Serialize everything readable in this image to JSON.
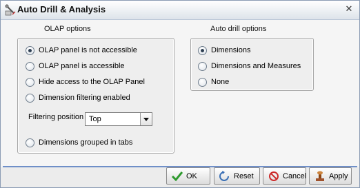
{
  "window": {
    "title": "Auto Drill & Analysis"
  },
  "olap": {
    "heading": "OLAP options",
    "options": [
      {
        "label": "OLAP panel is not accessible",
        "checked": true
      },
      {
        "label": "OLAP panel is accessible",
        "checked": false
      },
      {
        "label": "Hide access to the OLAP Panel",
        "checked": false
      },
      {
        "label": "Dimension filtering enabled",
        "checked": false
      }
    ],
    "filtering_position_label": "Filtering position",
    "filtering_position_value": "Top",
    "grouped_option": {
      "label": "Dimensions grouped in tabs",
      "checked": false
    }
  },
  "autodrill": {
    "heading": "Auto drill options",
    "options": [
      {
        "label": "Dimensions",
        "checked": true
      },
      {
        "label": "Dimensions and Measures",
        "checked": false
      },
      {
        "label": "None",
        "checked": false
      }
    ]
  },
  "buttons": {
    "ok": "OK",
    "reset": "Reset",
    "cancel": "Cancel",
    "apply": "Apply"
  },
  "icons": {
    "title": "drill-wrench-icon",
    "close": "close-icon",
    "ok": "checkmark-icon",
    "reset": "reset-icon",
    "cancel": "cancel-icon",
    "apply": "apply-stamp-icon"
  },
  "colors": {
    "accent": "#6f8fc8",
    "ok_green": "#2e9a2e",
    "cancel_red": "#cc2a2a",
    "reset_blue": "#3a6fb5"
  }
}
